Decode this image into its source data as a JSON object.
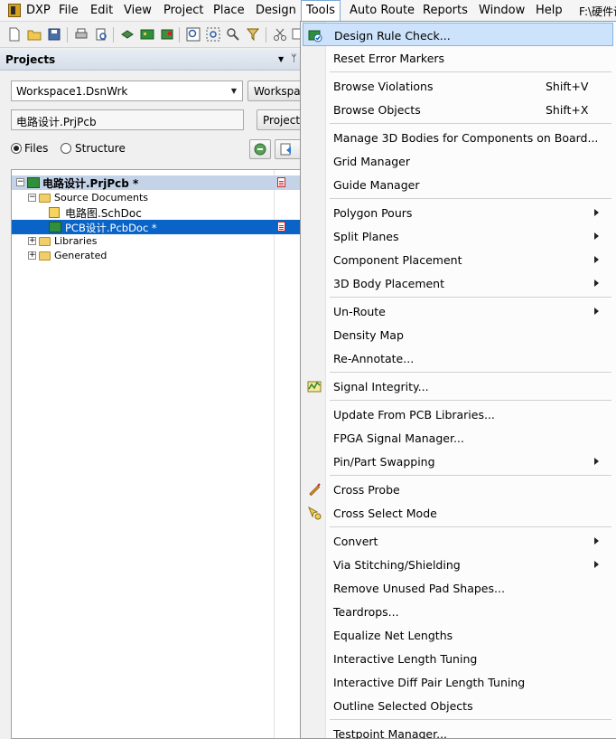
{
  "menubar": {
    "items": [
      "DXP",
      "File",
      "Edit",
      "View",
      "Project",
      "Place",
      "Design",
      "Tools",
      "Auto Route",
      "Reports",
      "Window",
      "Help",
      "F:\\硬件设"
    ]
  },
  "panel": {
    "title": "Projects",
    "workspace_select": "Workspace1.DsnWrk",
    "workspace_button": "Workspace",
    "project_field": "电路设计.PrjPcb",
    "project_button": "Project",
    "view_files": "Files",
    "view_structure": "Structure",
    "view_selected": "Files"
  },
  "tree": {
    "project": "电路设计.PrjPcb *",
    "source_folder": "Source Documents",
    "schdoc": "电路图.SchDoc",
    "pcbdoc": "PCB设计.PcbDoc *",
    "libraries": "Libraries",
    "generated": "Generated"
  },
  "menu": {
    "items": [
      {
        "label": "Design Rule Check...",
        "shortcut": "",
        "submenu": false,
        "icon": "drc-icon",
        "highlighted": true
      },
      {
        "label": "Reset Error Markers",
        "shortcut": "",
        "submenu": false
      },
      {
        "label": "Browse Violations",
        "shortcut": "Shift+V",
        "submenu": false
      },
      {
        "label": "Browse Objects",
        "shortcut": "Shift+X",
        "submenu": false
      },
      {
        "label": "Manage 3D Bodies for Components on Board...",
        "shortcut": "",
        "submenu": false
      },
      {
        "label": "Grid Manager",
        "shortcut": "",
        "submenu": false
      },
      {
        "label": "Guide Manager",
        "shortcut": "",
        "submenu": false
      },
      {
        "label": "Polygon Pours",
        "shortcut": "",
        "submenu": true
      },
      {
        "label": "Split Planes",
        "shortcut": "",
        "submenu": true
      },
      {
        "label": "Component Placement",
        "shortcut": "",
        "submenu": true
      },
      {
        "label": "3D Body Placement",
        "shortcut": "",
        "submenu": true
      },
      {
        "label": "Un-Route",
        "shortcut": "",
        "submenu": true
      },
      {
        "label": "Density Map",
        "shortcut": "",
        "submenu": false
      },
      {
        "label": "Re-Annotate...",
        "shortcut": "",
        "submenu": false
      },
      {
        "label": "Signal Integrity...",
        "shortcut": "",
        "submenu": false,
        "icon": "signal-integrity-icon"
      },
      {
        "label": "Update From PCB Libraries...",
        "shortcut": "",
        "submenu": false
      },
      {
        "label": "FPGA Signal Manager...",
        "shortcut": "",
        "submenu": false
      },
      {
        "label": "Pin/Part Swapping",
        "shortcut": "",
        "submenu": true
      },
      {
        "label": "Cross Probe",
        "shortcut": "",
        "submenu": false,
        "icon": "cross-probe-icon"
      },
      {
        "label": "Cross Select Mode",
        "shortcut": "",
        "submenu": false,
        "icon": "cross-select-icon"
      },
      {
        "label": "Convert",
        "shortcut": "",
        "submenu": true
      },
      {
        "label": "Via Stitching/Shielding",
        "shortcut": "",
        "submenu": true
      },
      {
        "label": "Remove Unused Pad Shapes...",
        "shortcut": "",
        "submenu": false
      },
      {
        "label": "Teardrops...",
        "shortcut": "",
        "submenu": false
      },
      {
        "label": "Equalize Net Lengths",
        "shortcut": "",
        "submenu": false
      },
      {
        "label": "Interactive Length Tuning",
        "shortcut": "",
        "submenu": false
      },
      {
        "label": "Interactive Diff Pair Length Tuning",
        "shortcut": "",
        "submenu": false
      },
      {
        "label": "Outline Selected Objects",
        "shortcut": "",
        "submenu": false
      },
      {
        "label": "Testpoint Manager...",
        "shortcut": "",
        "submenu": false
      }
    ]
  },
  "colors": {
    "menu_highlight": "#cde3fb",
    "tree_selection": "#0a64c8",
    "project_row": "#c4d3e8"
  }
}
